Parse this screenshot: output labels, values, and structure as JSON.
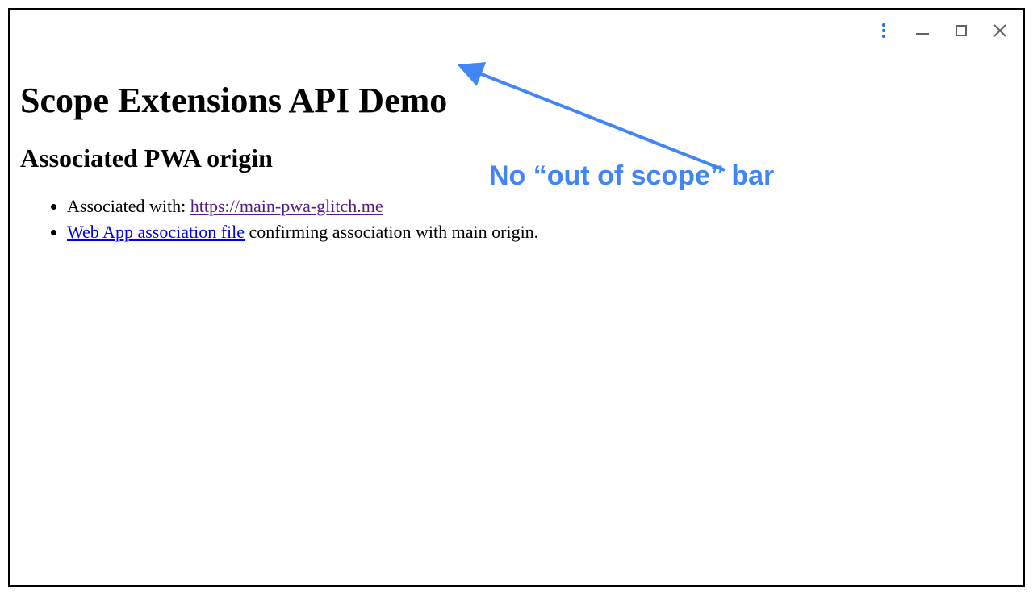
{
  "page": {
    "title": "Scope Extensions API Demo",
    "subheading": "Associated PWA origin"
  },
  "list": {
    "item1_prefix": "Associated with: ",
    "item1_link": "https://main-pwa-glitch.me",
    "item2_link": "Web App association file",
    "item2_suffix": " confirming association with main origin."
  },
  "annotation": {
    "text": "No “out of scope” bar",
    "color": "#4285f4"
  },
  "window_controls": {
    "menu": "menu",
    "minimize": "minimize",
    "maximize": "maximize",
    "close": "close"
  }
}
